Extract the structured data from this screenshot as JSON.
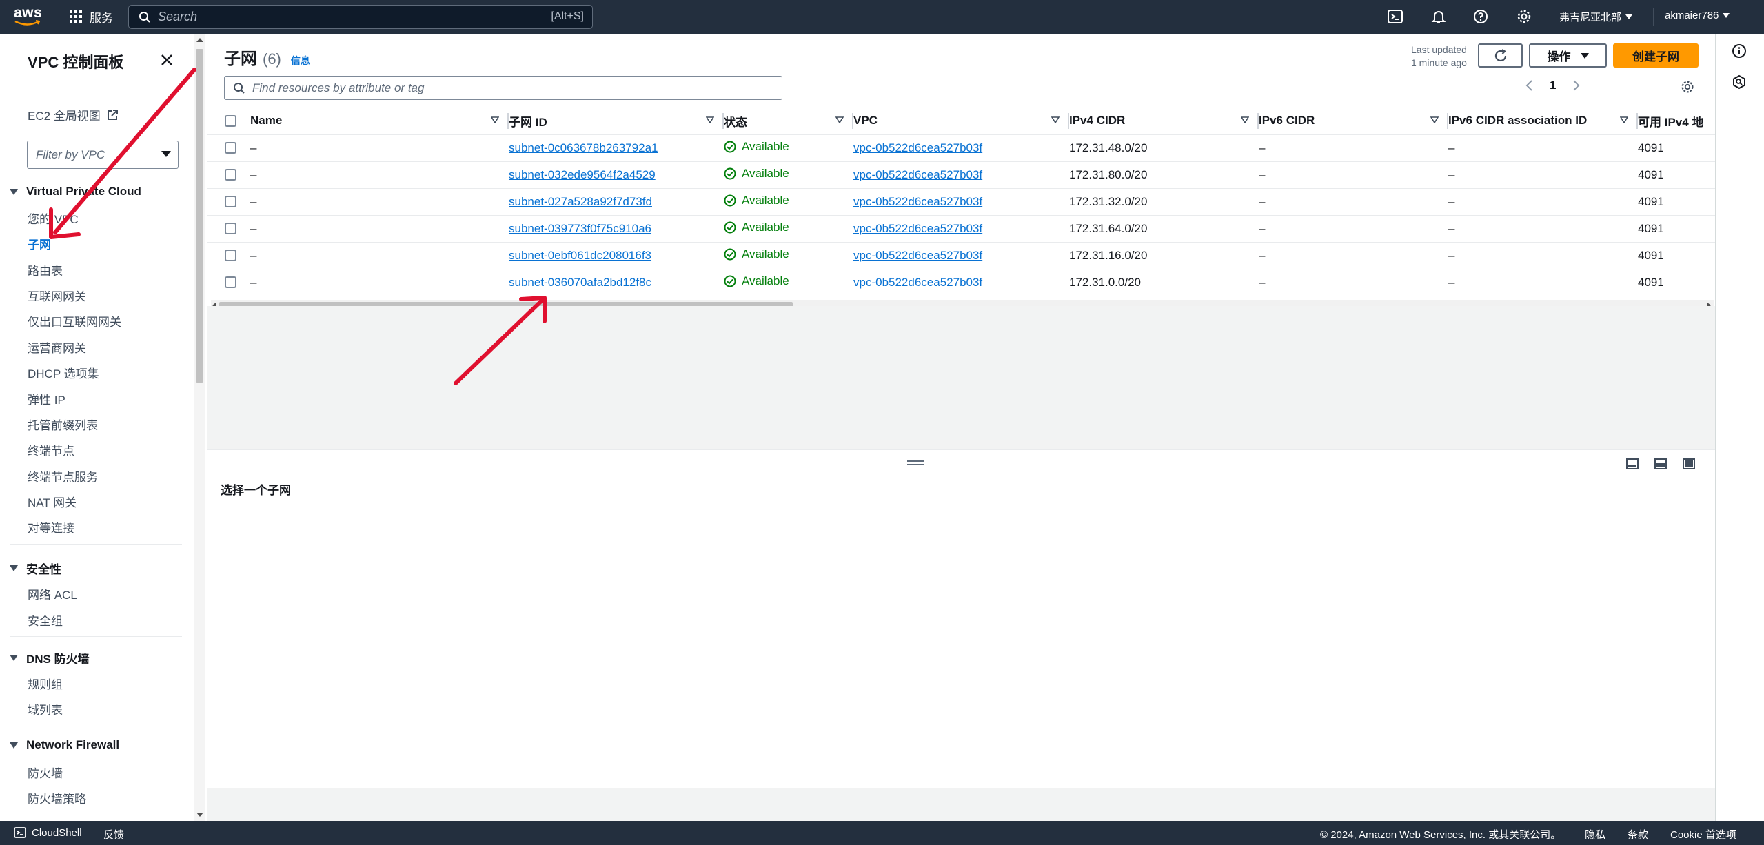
{
  "topnav": {
    "logo_text": "aws",
    "services_label": "服务",
    "search_placeholder": "Search",
    "search_shortcut": "[Alt+S]",
    "region": "弗吉尼亚北部",
    "account": "akmaier786"
  },
  "sidebar": {
    "title": "VPC 控制面板",
    "ec2_link": "EC2 全局视图",
    "filter_placeholder": "Filter by VPC",
    "sections": [
      {
        "title": "Virtual Private Cloud",
        "items": [
          "您的 VPC",
          "子网",
          "路由表",
          "互联网网关",
          "仅出口互联网网关",
          "运营商网关",
          "DHCP 选项集",
          "弹性 IP",
          "托管前缀列表",
          "终端节点",
          "终端节点服务",
          "NAT 网关",
          "对等连接"
        ]
      },
      {
        "title": "安全性",
        "items": [
          "网络 ACL",
          "安全组"
        ]
      },
      {
        "title": "DNS 防火墙",
        "items": [
          "规则组",
          "域列表"
        ]
      },
      {
        "title": "Network Firewall",
        "items": [
          "防火墙",
          "防火墙策略"
        ]
      }
    ],
    "active_item": "子网"
  },
  "main": {
    "title": "子网",
    "count": "(6)",
    "info_link": "信息",
    "last_updated_line1": "Last updated",
    "last_updated_line2": "1 minute ago",
    "actions_label": "操作",
    "create_label": "创建子网",
    "filter_placeholder": "Find resources by attribute or tag",
    "page_number": "1",
    "columns": [
      "Name",
      "子网 ID",
      "状态",
      "VPC",
      "IPv4 CIDR",
      "IPv6 CIDR",
      "IPv6 CIDR association ID",
      "可用 IPv4 地"
    ],
    "rows": [
      {
        "name": "–",
        "subnet_id": "subnet-0c063678b263792a1",
        "status": "Available",
        "vpc": "vpc-0b522d6cea527b03f",
        "ipv4": "172.31.48.0/20",
        "ipv6": "–",
        "assoc": "–",
        "avail": "4091"
      },
      {
        "name": "–",
        "subnet_id": "subnet-032ede9564f2a4529",
        "status": "Available",
        "vpc": "vpc-0b522d6cea527b03f",
        "ipv4": "172.31.80.0/20",
        "ipv6": "–",
        "assoc": "–",
        "avail": "4091"
      },
      {
        "name": "–",
        "subnet_id": "subnet-027a528a92f7d73fd",
        "status": "Available",
        "vpc": "vpc-0b522d6cea527b03f",
        "ipv4": "172.31.32.0/20",
        "ipv6": "–",
        "assoc": "–",
        "avail": "4091"
      },
      {
        "name": "–",
        "subnet_id": "subnet-039773f0f75c910a6",
        "status": "Available",
        "vpc": "vpc-0b522d6cea527b03f",
        "ipv4": "172.31.64.0/20",
        "ipv6": "–",
        "assoc": "–",
        "avail": "4091"
      },
      {
        "name": "–",
        "subnet_id": "subnet-0ebf061dc208016f3",
        "status": "Available",
        "vpc": "vpc-0b522d6cea527b03f",
        "ipv4": "172.31.16.0/20",
        "ipv6": "–",
        "assoc": "–",
        "avail": "4091"
      },
      {
        "name": "–",
        "subnet_id": "subnet-036070afa2bd12f8c",
        "status": "Available",
        "vpc": "vpc-0b522d6cea527b03f",
        "ipv4": "172.31.0.0/20",
        "ipv6": "–",
        "assoc": "–",
        "avail": "4091"
      }
    ],
    "details_title": "选择一个子网"
  },
  "footer": {
    "cloudshell": "CloudShell",
    "feedback": "反馈",
    "copyright": "© 2024, Amazon Web Services, Inc. 或其关联公司。",
    "privacy": "隐私",
    "terms": "条款",
    "cookie": "Cookie 首选项"
  },
  "colors": {
    "nav_bg": "#232f3e",
    "link": "#0972d3",
    "primary_button": "#ff9900",
    "status_ok": "#037f0c",
    "annotation_arrow": "#e0102f"
  }
}
